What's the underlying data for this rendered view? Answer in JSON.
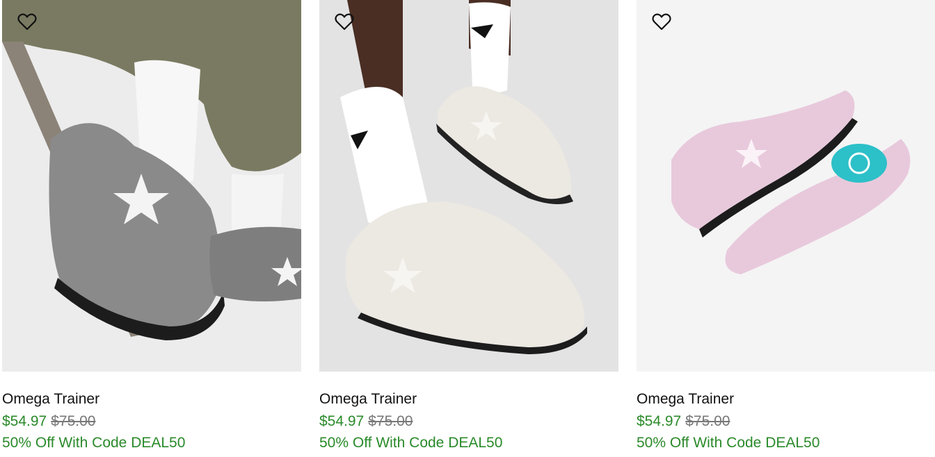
{
  "products": [
    {
      "name": "Omega Trainer",
      "sale_price": "$54.97",
      "original_price": "$75.00",
      "promo": "50% Off With Code DEAL50",
      "image_desc": "grey sneakers on a person sitting on a chair",
      "shoe_color": "#8a8a8a"
    },
    {
      "name": "Omega Trainer",
      "sale_price": "$54.97",
      "original_price": "$75.00",
      "promo": "50% Off With Code DEAL50",
      "image_desc": "off-white sneakers with white socks",
      "shoe_color": "#ece8e2"
    },
    {
      "name": "Omega Trainer",
      "sale_price": "$54.97",
      "original_price": "$75.00",
      "promo": "50% Off With Code DEAL50",
      "image_desc": "pair of pink sneakers",
      "shoe_color": "#e8c9dc"
    }
  ],
  "icons": {
    "wishlist": "heart-outline-icon"
  },
  "colors": {
    "sale": "#2a8a2a",
    "original": "#777777",
    "title": "#111111"
  }
}
